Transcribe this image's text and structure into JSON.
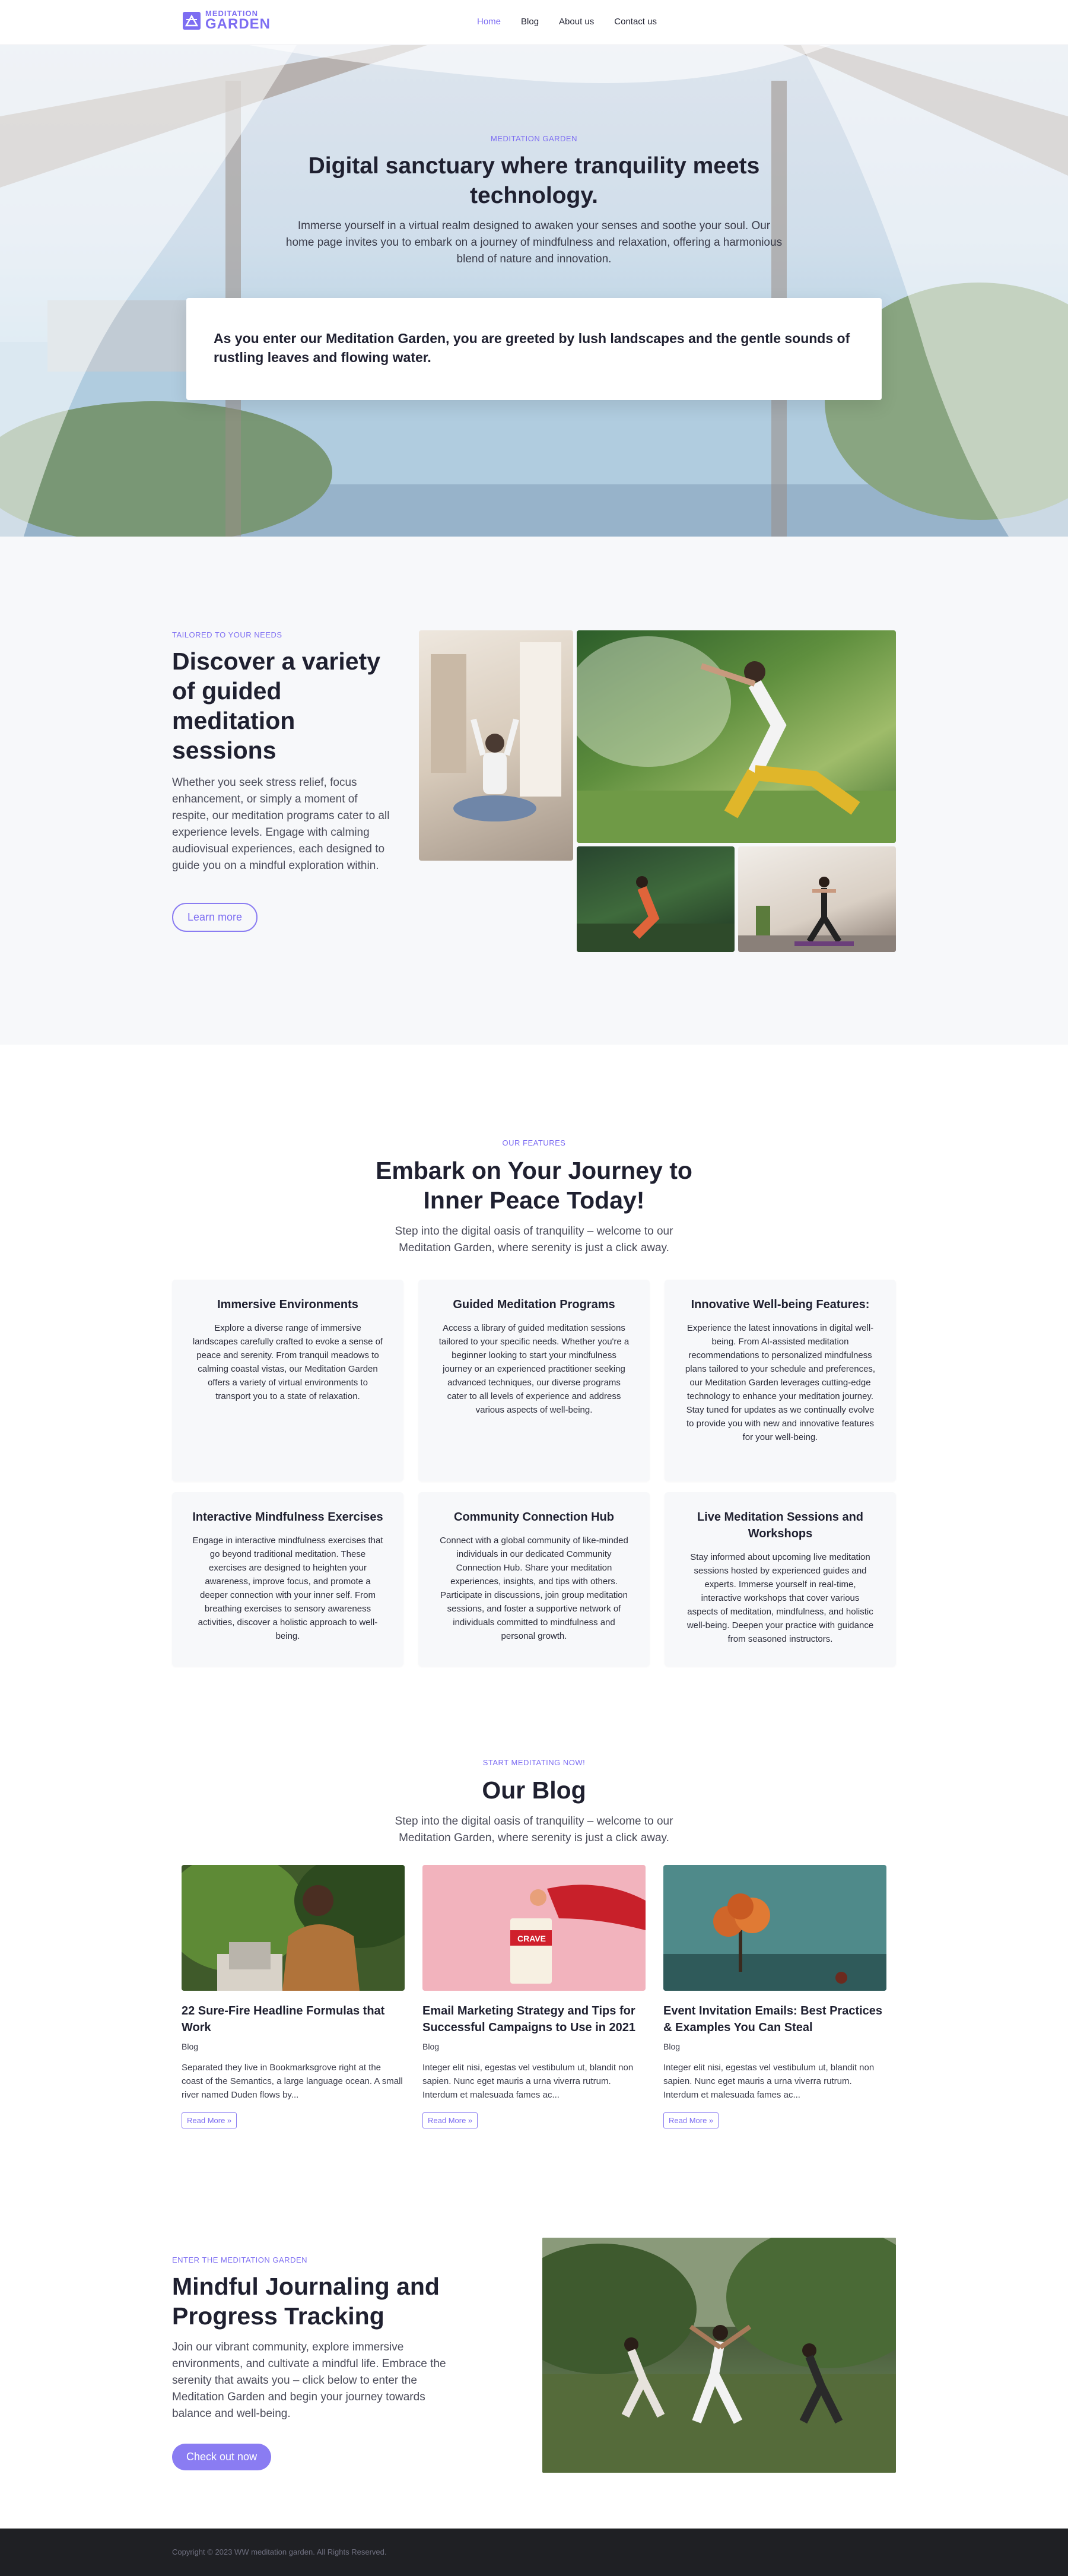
{
  "nav": {
    "logo_line1": "MEDITATION",
    "logo_line2": "GARDEN",
    "items": [
      {
        "label": "Home",
        "active": true
      },
      {
        "label": "Blog",
        "active": false
      },
      {
        "label": "About us",
        "active": false
      },
      {
        "label": "Contact us",
        "active": false
      }
    ]
  },
  "hero": {
    "eyebrow": "MEDITATION GARDEN",
    "title": "Digital sanctuary where tranquility meets technology.",
    "subtitle": "Immerse yourself in a virtual realm designed to awaken your senses and soothe your soul. Our home page invites you to embark on a journey of mindfulness and relaxation, offering a harmonious blend of nature and innovation.",
    "card_text": "As you enter our Meditation Garden, you are greeted by lush landscapes and the gentle sounds of rustling leaves and flowing water."
  },
  "services": {
    "eyebrow": "TAILORED TO YOUR NEEDS",
    "title": "Discover a variety of guided meditation sessions",
    "body": "Whether you seek stress relief, focus enhancement, or simply a moment of respite, our meditation programs cater to all experience levels. Engage with calming audiovisual experiences, each designed to guide you on a mindful exploration within.",
    "button": "Learn more"
  },
  "features": {
    "eyebrow": "OUR FEATURES",
    "title": "Embark on Your Journey to Inner Peace Today!",
    "subtitle": "Step into the digital oasis of tranquility – welcome to our Meditation Garden, where serenity is just a click away.",
    "cards": [
      {
        "title": "Immersive Environments",
        "body": "Explore a diverse range of immersive landscapes carefully crafted to evoke a sense of peace and serenity. From tranquil meadows to calming coastal vistas, our Meditation Garden offers a variety of virtual environments to transport you to a state of relaxation."
      },
      {
        "title": "Guided Meditation Programs",
        "body": "Access a library of guided meditation sessions tailored to your specific needs. Whether you're a beginner looking to start your mindfulness journey or an experienced practitioner seeking advanced techniques, our diverse programs cater to all levels of experience and address various aspects of well-being."
      },
      {
        "title": "Innovative Well-being Features:",
        "body": "Experience the latest innovations in digital well-being. From AI-assisted meditation recommendations to personalized mindfulness plans tailored to your schedule and preferences, our Meditation Garden leverages cutting-edge technology to enhance your meditation journey. Stay tuned for updates as we continually evolve to provide you with new and innovative features for your well-being."
      },
      {
        "title": "Interactive Mindfulness Exercises",
        "body": "Engage in interactive mindfulness exercises that go beyond traditional meditation. These exercises are designed to heighten your awareness, improve focus, and promote a deeper connection with your inner self. From breathing exercises to sensory awareness activities, discover a holistic approach to well-being."
      },
      {
        "title": "Community Connection Hub",
        "body": "Connect with a global community of like-minded individuals in our dedicated Community Connection Hub. Share your meditation experiences, insights, and tips with others. Participate in discussions, join group meditation sessions, and foster a supportive network of individuals committed to mindfulness and personal growth."
      },
      {
        "title": "Live Meditation Sessions and Workshops",
        "body": "Stay informed about upcoming live meditation sessions hosted by experienced guides and experts. Immerse yourself in real-time, interactive workshops that cover various aspects of meditation, mindfulness, and holistic well-being. Deepen your practice with guidance from seasoned instructors."
      }
    ]
  },
  "blog": {
    "eyebrow": "START MEDITATING NOW!",
    "title": "Our Blog",
    "subtitle": "Step into the digital oasis of tranquility – welcome to our Meditation Garden, where serenity is just a click away.",
    "posts": [
      {
        "title": "22 Sure-Fire Headline Formulas that Work",
        "category": "Blog",
        "excerpt": "Separated they live in Bookmarksgrove right at the coast of the Semantics, a large language ocean. A small river named Duden flows by...",
        "read_more": "Read More »"
      },
      {
        "title": "Email Marketing Strategy and Tips for Successful Campaigns to Use in 2021",
        "category": "Blog",
        "excerpt": "Integer elit nisi, egestas vel vestibulum ut, blandit non sapien. Nunc eget mauris a urna viverra rutrum. Interdum et malesuada fames ac...",
        "read_more": "Read More »",
        "package_line1": "CRAVE"
      },
      {
        "title": "Event Invitation Emails: Best Practices & Examples You Can Steal",
        "category": "Blog",
        "excerpt": "Integer elit nisi, egestas vel vestibulum ut, blandit non sapien. Nunc eget mauris a urna viverra rutrum. Interdum et malesuada fames ac...",
        "read_more": "Read More »"
      }
    ]
  },
  "journal": {
    "eyebrow": "ENTER THE MEDITATION GARDEN",
    "title": "Mindful Journaling and Progress Tracking",
    "body": "Join our vibrant community, explore immersive environments, and cultivate a mindful life. Embrace the serenity that awaits you – click below to enter the Meditation Garden and begin your journey towards balance and well-being.",
    "button": "Check out now"
  },
  "footer": {
    "copyright": "Copyright © 2023 WW meditation garden. All Rights Reserved."
  },
  "colors": {
    "accent": "#7d6df2",
    "text": "#1f2030",
    "section_bg": "#f7f8fa",
    "footer_bg": "#1f2024"
  }
}
